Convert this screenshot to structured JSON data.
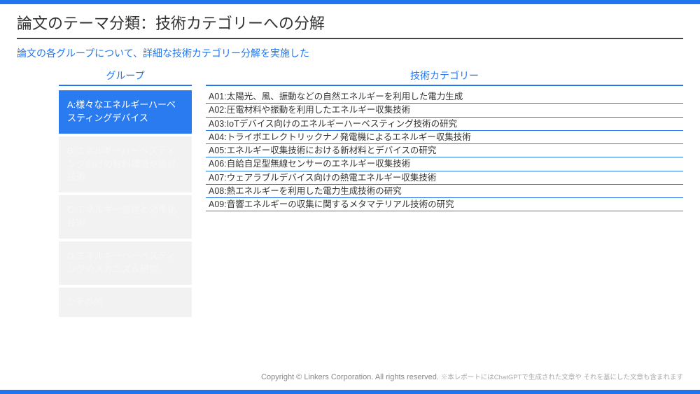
{
  "title": "論文のテーマ分類：技術カテゴリーへの分解",
  "subtitle": "論文の各グループについて、詳細な技術カテゴリー分解を実施した",
  "columns": {
    "group_label": "グループ",
    "category_label": "技術カテゴリー"
  },
  "groups": [
    {
      "label": "A:様々なエネルギーハーベスティングデバイス",
      "active": true
    },
    {
      "label": "B:エネルギーハーベスティング向けの材料構造や設計技術",
      "active": false
    },
    {
      "label": "C:エネルギー管理と効率化技術",
      "active": false
    },
    {
      "label": "D:エネルギーハーベスティングのメカニズム研究",
      "active": false
    },
    {
      "label": "Z:その他",
      "active": false
    }
  ],
  "categories": [
    "A01:太陽光、風、振動などの自然エネルギーを利用した電力生成",
    "A02:圧電材料や振動を利用したエネルギー収集技術",
    "A03:IoTデバイス向けのエネルギーハーベスティング技術の研究",
    "A04:トライボエレクトリックナノ発電機によるエネルギー収集技術",
    "A05:エネルギー収集技術における新材料とデバイスの研究",
    "A06:自給自足型無線センサーのエネルギー収集技術",
    "A07:ウェアラブルデバイス向けの熱電エネルギー収集技術",
    "A08:熱エネルギーを利用した電力生成技術の研究",
    "A09:音響エネルギーの収集に関するメタマテリアル技術の研究"
  ],
  "footer": {
    "copyright": "Copyright © Linkers Corporation. All rights reserved.",
    "note": "※本レポートにはChatGPTで生成された文章や それを基にした文章も含まれます"
  }
}
